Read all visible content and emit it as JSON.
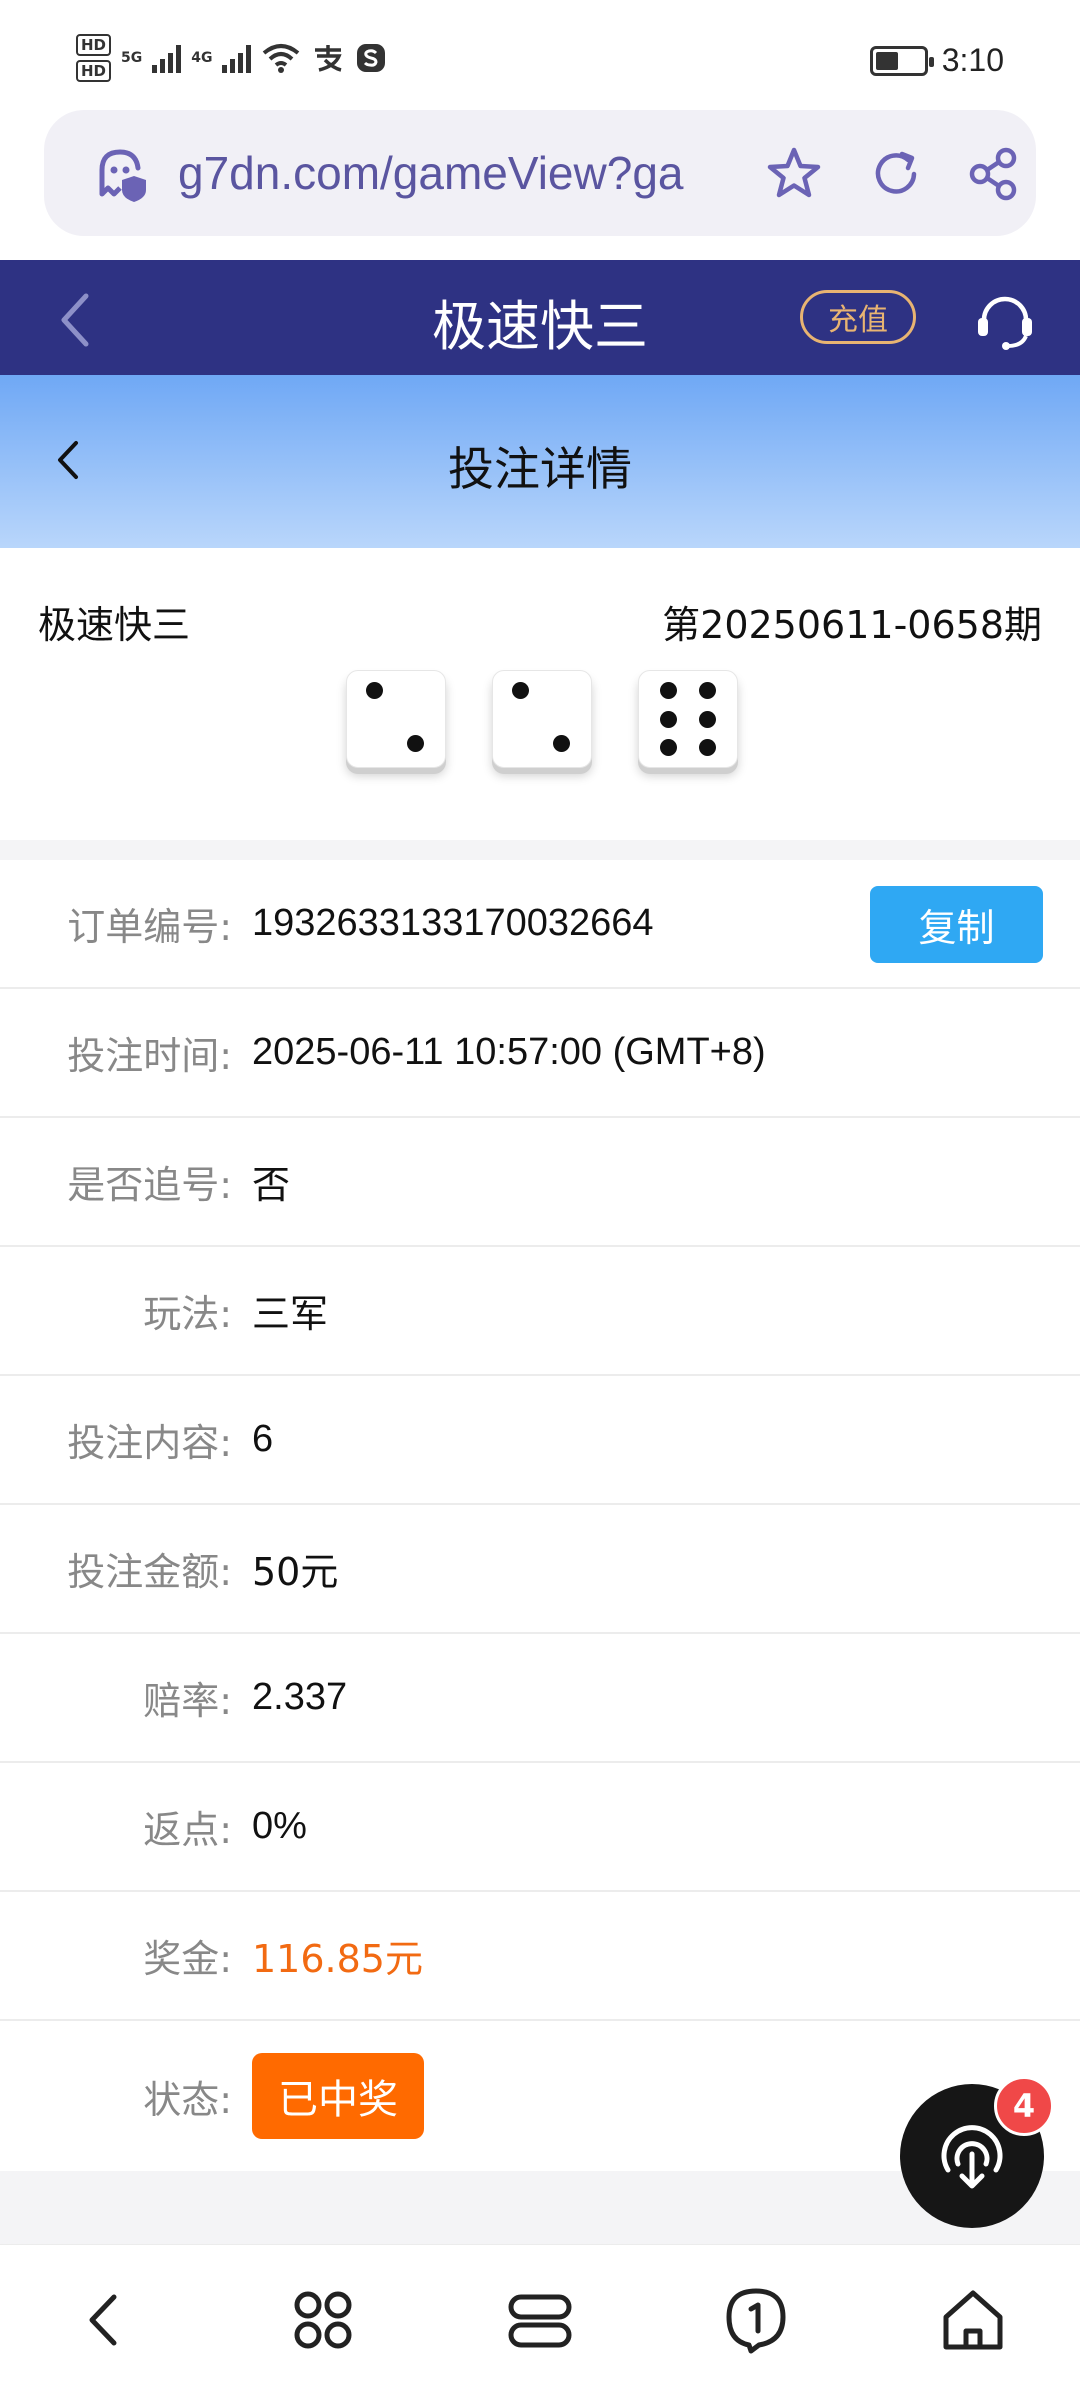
{
  "status_bar": {
    "hd1": "HD",
    "hd2": "HD",
    "net1": "5G",
    "net2": "4G",
    "time": "3:10"
  },
  "browser": {
    "url": "g7dn.com/gameView?ga"
  },
  "app_header": {
    "title": "极速快三",
    "recharge_label": "充值"
  },
  "sub_header": {
    "title": "投注详情"
  },
  "lottery": {
    "name": "极速快三",
    "period": "第20250611-0658期",
    "dice": [
      2,
      2,
      6
    ]
  },
  "details": {
    "order_no_label": "订单编号:",
    "order_no": "1932633133170032664",
    "copy_label": "复制",
    "bet_time_label": "投注时间:",
    "bet_time": "2025-06-11 10:57:00 (GMT+8)",
    "chase_label": "是否追号:",
    "chase": "否",
    "play_label": "玩法:",
    "play": "三军",
    "content_label": "投注内容:",
    "content": "6",
    "amount_label": "投注金额:",
    "amount": "50元",
    "odds_label": "赔率:",
    "odds": "2.337",
    "rebate_label": "返点:",
    "rebate": "0%",
    "prize_label": "奖金:",
    "prize": "116.85元",
    "status_label": "状态:",
    "status": "已中奖"
  },
  "float": {
    "badge": "4"
  },
  "colors": {
    "header_bg": "#2e3283",
    "accent_gold": "#e8b472",
    "copy_blue": "#2fa8f3",
    "prize_orange": "#f26a12",
    "status_orange": "#ff6a00"
  }
}
